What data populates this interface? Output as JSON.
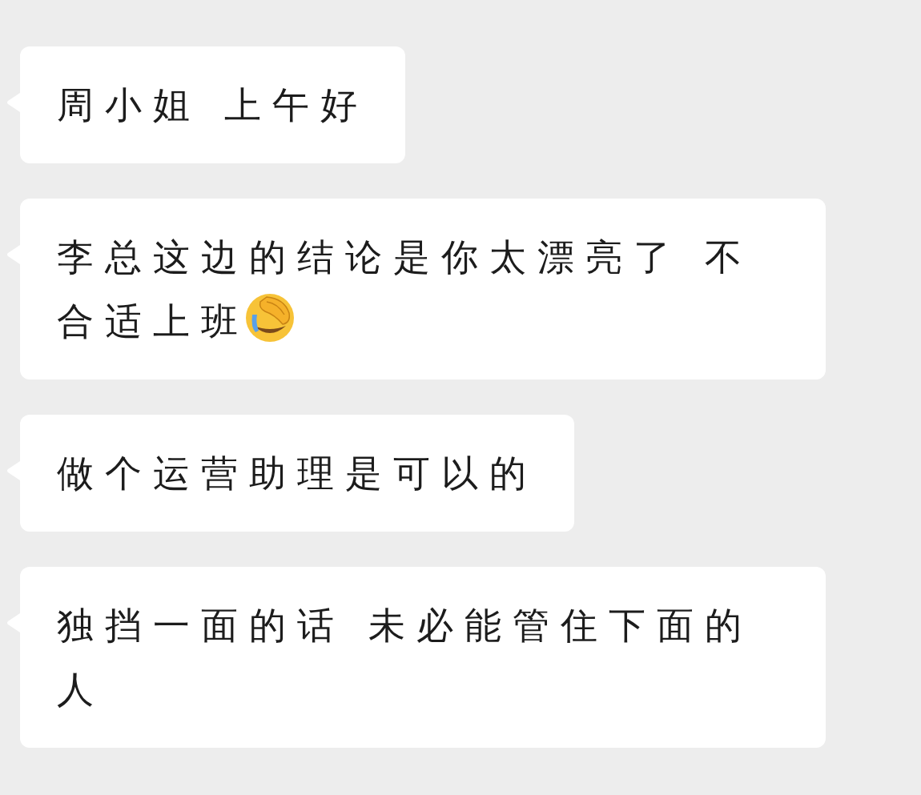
{
  "messages": [
    {
      "text": "周小姐 上午好",
      "emoji": false
    },
    {
      "text": "李总这边的结论是你太漂亮了 不合适上班",
      "emoji": true
    },
    {
      "text": "做个运营助理是可以的",
      "emoji": false
    },
    {
      "text": "独挡一面的话 未必能管住下面的人",
      "emoji": false
    }
  ]
}
